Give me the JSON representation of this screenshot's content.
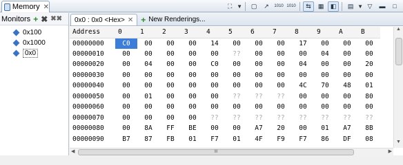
{
  "view": {
    "tab_label": "Memory",
    "tab_close": "✕"
  },
  "toolbar": {
    "text_1010_a": "1010",
    "text_1010_b": "1010"
  },
  "monitors": {
    "title": "Monitors",
    "items": [
      {
        "label": "0x100"
      },
      {
        "label": "0x1000"
      },
      {
        "label": "0x0"
      }
    ]
  },
  "renderings": {
    "active_tab": "0x0 : 0x0 <Hex>",
    "active_tab_close": "✕",
    "new_tab": "New Renderings..."
  },
  "table": {
    "headers": [
      "Address",
      "0",
      "1",
      "2",
      "3",
      "4",
      "5",
      "6",
      "7",
      "8",
      "9",
      "A",
      "B"
    ],
    "rows": [
      [
        "00000000",
        "C0",
        "00",
        "00",
        "00",
        "14",
        "00",
        "00",
        "00",
        "17",
        "00",
        "00",
        "00"
      ],
      [
        "00000010",
        "00",
        "00",
        "00",
        "00",
        "00",
        "??",
        "00",
        "00",
        "00",
        "04",
        "00",
        "00"
      ],
      [
        "00000020",
        "00",
        "04",
        "00",
        "00",
        "C0",
        "00",
        "00",
        "00",
        "04",
        "00",
        "00",
        "20"
      ],
      [
        "00000030",
        "00",
        "00",
        "00",
        "00",
        "00",
        "00",
        "00",
        "00",
        "00",
        "00",
        "00",
        "00"
      ],
      [
        "00000040",
        "00",
        "00",
        "00",
        "00",
        "00",
        "00",
        "00",
        "00",
        "4C",
        "70",
        "48",
        "01"
      ],
      [
        "00000050",
        "00",
        "01",
        "00",
        "00",
        "00",
        "??",
        "??",
        "??",
        "00",
        "00",
        "00",
        "80"
      ],
      [
        "00000060",
        "00",
        "00",
        "00",
        "00",
        "00",
        "00",
        "00",
        "00",
        "00",
        "00",
        "00",
        "00"
      ],
      [
        "00000070",
        "00",
        "00",
        "00",
        "00",
        "??",
        "??",
        "??",
        "??",
        "??",
        "??",
        "??",
        "??"
      ],
      [
        "00000080",
        "00",
        "8A",
        "FF",
        "BE",
        "00",
        "00",
        "A7",
        "20",
        "00",
        "01",
        "A7",
        "8B"
      ],
      [
        "00000090",
        "B7",
        "87",
        "FB",
        "01",
        "F7",
        "01",
        "4F",
        "F9",
        "F7",
        "86",
        "DF",
        "08"
      ]
    ]
  },
  "scrollbar": {
    "grip": "III"
  },
  "colors": {
    "selection": "#3b7dd8",
    "unknown_byte": "#a9a9a9",
    "monitor_icon": "#3a72c4",
    "add_icon": "#2e8b2e"
  }
}
